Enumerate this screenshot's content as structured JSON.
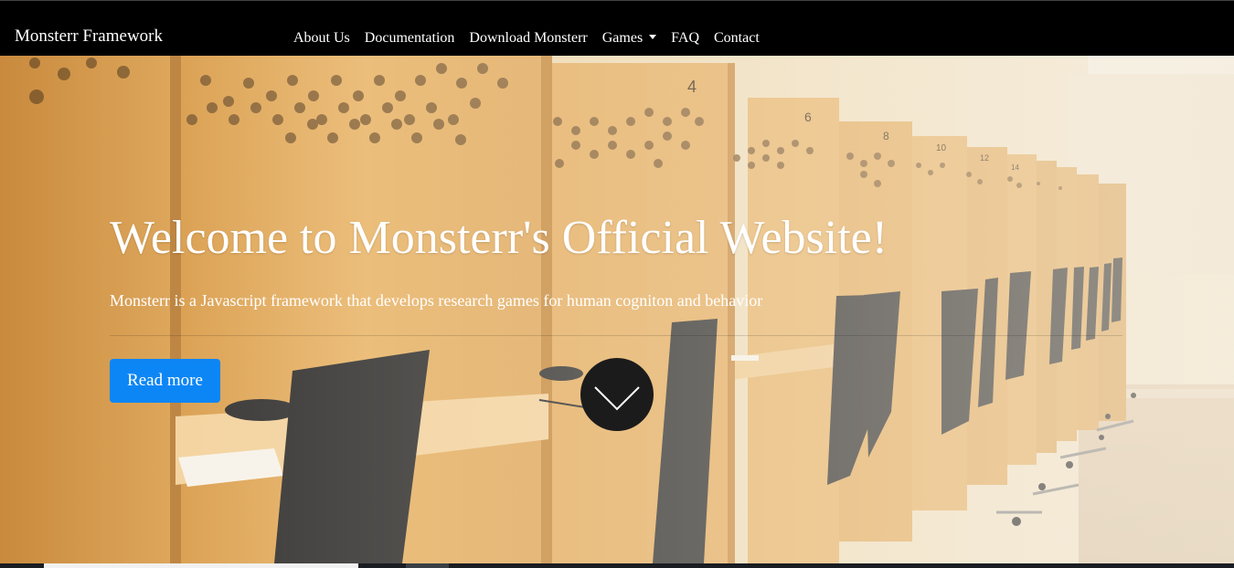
{
  "navbar": {
    "brand": "Monsterr Framework",
    "links": [
      {
        "label": "About Us"
      },
      {
        "label": "Documentation"
      },
      {
        "label": "Download Monsterr"
      },
      {
        "label": "Games"
      },
      {
        "label": "FAQ"
      },
      {
        "label": "Contact"
      }
    ]
  },
  "hero": {
    "title": "Welcome to Monsterr's Official Website!",
    "subtitle": "Monsterr is a Javascript framework that develops research games for human cogniton and behavior",
    "read_more_label": "Read more",
    "cubicle_numbers": [
      "4",
      "6",
      "8",
      "10",
      "12",
      "14"
    ],
    "scroll_icon": "chevron-down-icon"
  },
  "colors": {
    "navbar_bg": "#000000",
    "button_primary": "#0d86f5",
    "wood": "#e3a955",
    "chair": "#2b2a28",
    "wall": "#efe4cf"
  }
}
